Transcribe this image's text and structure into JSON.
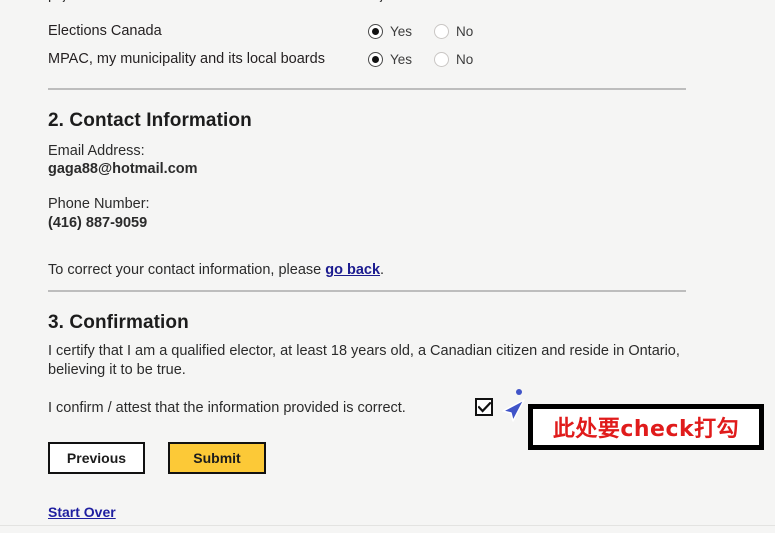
{
  "page": {
    "background_color": "#f5f5f4",
    "cut_off_top_line": {
      "left_fragment": "pry",
      "right_fragment": "y"
    }
  },
  "consent_questions": {
    "rows": [
      {
        "label": "Elections Canada",
        "options": [
          {
            "label": "Yes",
            "selected": true
          },
          {
            "label": "No",
            "selected": false
          }
        ]
      },
      {
        "label": "MPAC, my municipality and its local boards",
        "options": [
          {
            "label": "Yes",
            "selected": true
          },
          {
            "label": "No",
            "selected": false
          }
        ]
      }
    ]
  },
  "contact_information": {
    "heading": "2. Contact Information",
    "email_label": "Email Address:",
    "email_value": "gaga88@hotmail.com",
    "phone_label": "Phone Number:",
    "phone_value": "(416) 887-9059",
    "correction_note_prefix": "To correct your contact information, please ",
    "correction_link": "go back",
    "correction_note_suffix": "."
  },
  "confirmation": {
    "heading": "3. Confirmation",
    "certify_text": "I certify that I am a qualified elector, at least 18 years old, a Canadian citizen and reside in Ontario, believing it to be true.",
    "confirm_label": "I confirm / attest that the information provided is correct.",
    "checkbox_checked": true
  },
  "actions": {
    "previous_label": "Previous",
    "submit_label": "Submit",
    "submit_color": "#fcc937",
    "start_over_label": "Start Over",
    "link_color": "#1f1fa0"
  },
  "annotation": {
    "text": "此处要check打勾",
    "text_color": "#e01b1b",
    "border_color": "#000000",
    "cursor_color": "#4054c8"
  }
}
